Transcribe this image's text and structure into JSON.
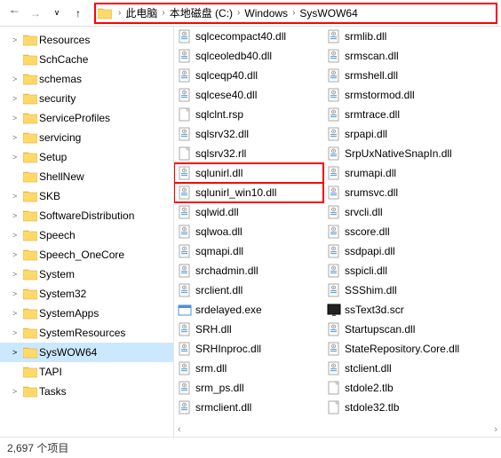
{
  "breadcrumb": {
    "items": [
      "此电脑",
      "本地磁盘 (C:)",
      "Windows",
      "SysWOW64"
    ]
  },
  "tree": [
    {
      "label": "Resources",
      "expandable": true
    },
    {
      "label": "SchCache",
      "expandable": false
    },
    {
      "label": "schemas",
      "expandable": true
    },
    {
      "label": "security",
      "expandable": true
    },
    {
      "label": "ServiceProfiles",
      "expandable": true
    },
    {
      "label": "servicing",
      "expandable": true
    },
    {
      "label": "Setup",
      "expandable": true
    },
    {
      "label": "ShellNew",
      "expandable": false
    },
    {
      "label": "SKB",
      "expandable": true
    },
    {
      "label": "SoftwareDistribution",
      "expandable": true
    },
    {
      "label": "Speech",
      "expandable": true
    },
    {
      "label": "Speech_OneCore",
      "expandable": true
    },
    {
      "label": "System",
      "expandable": true
    },
    {
      "label": "System32",
      "expandable": true
    },
    {
      "label": "SystemApps",
      "expandable": true
    },
    {
      "label": "SystemResources",
      "expandable": true
    },
    {
      "label": "SysWOW64",
      "expandable": true,
      "selected": true
    },
    {
      "label": "TAPI",
      "expandable": false
    },
    {
      "label": "Tasks",
      "expandable": true
    }
  ],
  "files_col1": [
    {
      "label": "sqlcecompact40.dll",
      "icon": "dll"
    },
    {
      "label": "sqlceoledb40.dll",
      "icon": "dll"
    },
    {
      "label": "sqlceqp40.dll",
      "icon": "dll"
    },
    {
      "label": "sqlcese40.dll",
      "icon": "dll"
    },
    {
      "label": "sqlclnt.rsp",
      "icon": "file"
    },
    {
      "label": "sqlsrv32.dll",
      "icon": "dll"
    },
    {
      "label": "sqlsrv32.rll",
      "icon": "file"
    },
    {
      "label": "sqlunirl.dll",
      "icon": "dll",
      "hl": true
    },
    {
      "label": "sqlunirl_win10.dll",
      "icon": "dll",
      "hl": true
    },
    {
      "label": "sqlwid.dll",
      "icon": "dll"
    },
    {
      "label": "sqlwoa.dll",
      "icon": "dll"
    },
    {
      "label": "sqmapi.dll",
      "icon": "dll"
    },
    {
      "label": "srchadmin.dll",
      "icon": "dll"
    },
    {
      "label": "srclient.dll",
      "icon": "dll"
    },
    {
      "label": "srdelayed.exe",
      "icon": "exe"
    },
    {
      "label": "SRH.dll",
      "icon": "dll"
    },
    {
      "label": "SRHInproc.dll",
      "icon": "dll"
    },
    {
      "label": "srm.dll",
      "icon": "dll"
    },
    {
      "label": "srm_ps.dll",
      "icon": "dll"
    },
    {
      "label": "srmclient.dll",
      "icon": "dll"
    }
  ],
  "files_col2": [
    {
      "label": "srmlib.dll",
      "icon": "dll"
    },
    {
      "label": "srmscan.dll",
      "icon": "dll"
    },
    {
      "label": "srmshell.dll",
      "icon": "dll"
    },
    {
      "label": "srmstormod.dll",
      "icon": "dll"
    },
    {
      "label": "srmtrace.dll",
      "icon": "dll"
    },
    {
      "label": "srpapi.dll",
      "icon": "dll"
    },
    {
      "label": "SrpUxNativeSnapIn.dll",
      "icon": "dll"
    },
    {
      "label": "srumapi.dll",
      "icon": "dll"
    },
    {
      "label": "srumsvc.dll",
      "icon": "dll"
    },
    {
      "label": "srvcli.dll",
      "icon": "dll"
    },
    {
      "label": "sscore.dll",
      "icon": "dll"
    },
    {
      "label": "ssdpapi.dll",
      "icon": "dll"
    },
    {
      "label": "sspicli.dll",
      "icon": "dll"
    },
    {
      "label": "SSShim.dll",
      "icon": "dll"
    },
    {
      "label": "ssText3d.scr",
      "icon": "scr"
    },
    {
      "label": "Startupscan.dll",
      "icon": "dll"
    },
    {
      "label": "StateRepository.Core.dll",
      "icon": "dll"
    },
    {
      "label": "stclient.dll",
      "icon": "dll"
    },
    {
      "label": "stdole2.tlb",
      "icon": "file"
    },
    {
      "label": "stdole32.tlb",
      "icon": "file"
    }
  ],
  "status": {
    "text": "2,697 个项目"
  }
}
